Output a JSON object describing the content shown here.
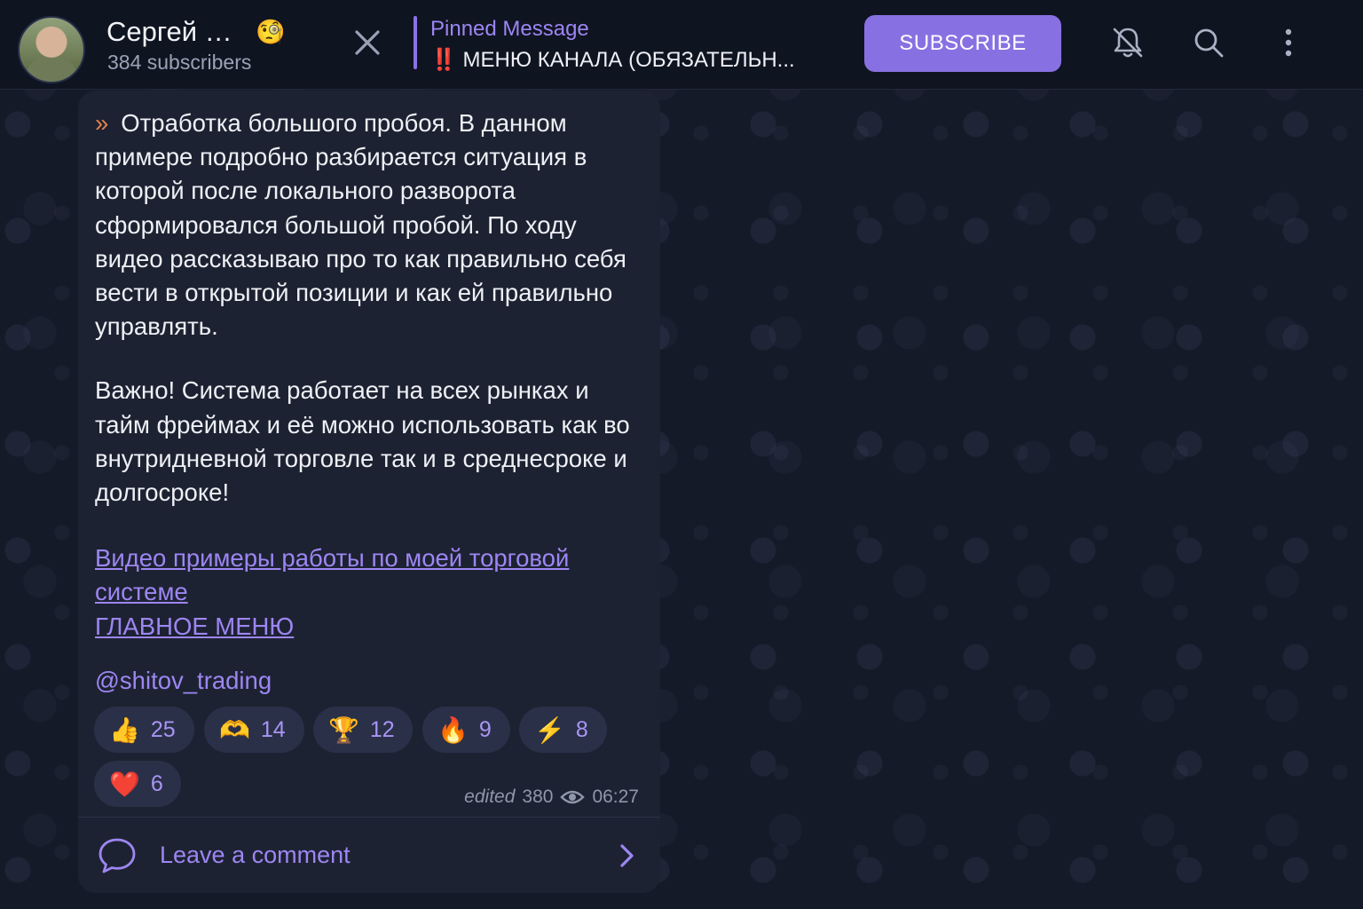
{
  "header": {
    "channel_name": "Сергей …",
    "name_emoji": "🧐",
    "subscribers": "384 subscribers",
    "pinned_title": "Pinned Message",
    "pinned_text": "‼️ МЕНЮ КАНАЛА (ОБЯЗАТЕЛЬН...",
    "subscribe_label": "SUBSCRIBE"
  },
  "message": {
    "quote_mark": "»",
    "paragraph1": "Отработка большого пробоя. В данном примере подробно разбирается ситуация в которой после локального разворота сформировался большой пробой. По ходу видео рассказываю про то как правильно себя вести в открытой позиции и как ей правильно управлять.",
    "paragraph2": "Важно! Система работает на всех рынках и тайм фреймах и её можно использовать как во внутридневной торговле так и в среднесроке и долгосроке!",
    "link1": "Видео примеры работы по моей торговой системе",
    "link2": "ГЛАВНОЕ МЕНЮ",
    "handle": "@shitov_trading",
    "reactions": [
      {
        "emoji": "👍",
        "count": "25"
      },
      {
        "emoji": "🫶",
        "count": "14"
      },
      {
        "emoji": "🏆",
        "count": "12"
      },
      {
        "emoji": "🔥",
        "count": "9"
      },
      {
        "emoji": "⚡",
        "count": "8"
      },
      {
        "emoji": "❤️",
        "count": "6"
      }
    ],
    "edited_label": "edited",
    "views": "380",
    "time": "06:27",
    "comment_label": "Leave a comment"
  },
  "colors": {
    "accent": "#8771e2",
    "link": "#9d86f2",
    "card_bg": "#1d2232",
    "header_bg": "#0f1421"
  },
  "icons": [
    "close-icon",
    "bell-off-icon",
    "search-icon",
    "more-vertical-icon",
    "eye-icon",
    "comment-bubble-icon",
    "chevron-right-icon"
  ]
}
